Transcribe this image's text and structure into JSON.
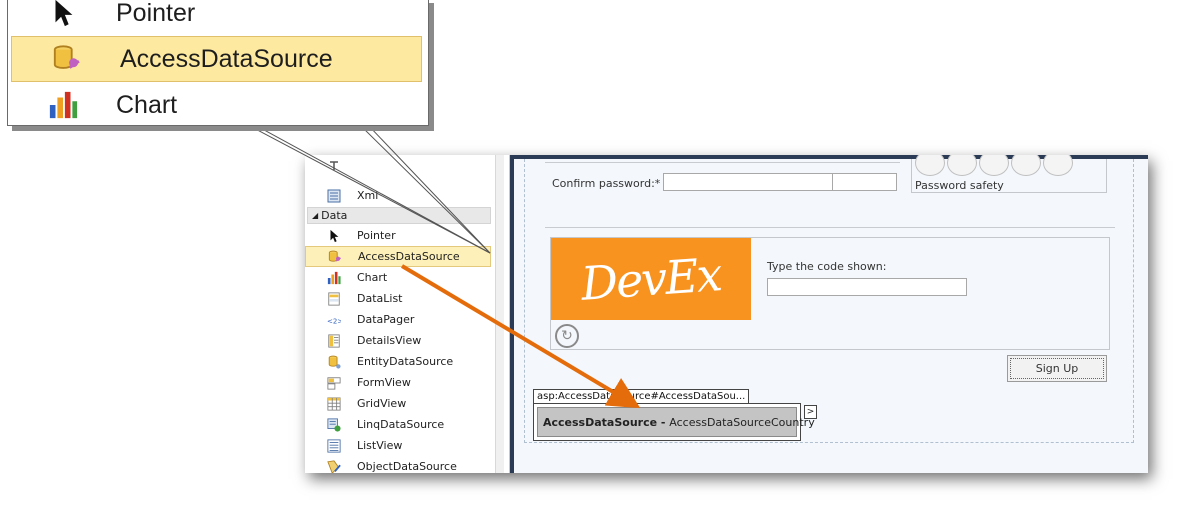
{
  "toolbox": {
    "partial_item": "Xml",
    "group_label": "Data",
    "items": [
      {
        "label": "Pointer",
        "icon": "pointer-icon"
      },
      {
        "label": "AccessDataSource",
        "icon": "access-data-source-icon"
      },
      {
        "label": "Chart",
        "icon": "chart-icon"
      },
      {
        "label": "DataList",
        "icon": "datalist-icon"
      },
      {
        "label": "DataPager",
        "icon": "datapager-icon"
      },
      {
        "label": "DetailsView",
        "icon": "detailsview-icon"
      },
      {
        "label": "EntityDataSource",
        "icon": "entity-data-source-icon"
      },
      {
        "label": "FormView",
        "icon": "formview-icon"
      },
      {
        "label": "GridView",
        "icon": "gridview-icon"
      },
      {
        "label": "LinqDataSource",
        "icon": "linq-data-source-icon"
      },
      {
        "label": "ListView",
        "icon": "listview-icon"
      },
      {
        "label": "ObjectDataSource",
        "icon": "object-data-source-icon"
      }
    ]
  },
  "designer": {
    "confirm_password_label": "Confirm password:*",
    "password_safety_label": "Password safety",
    "captcha_text": "DevEx",
    "captcha_prompt": "Type the code shown:",
    "signup_label": "Sign Up",
    "datasource_tag": "asp:AccessDataSource#AccessDataSou...",
    "datasource_type": "AccessDataSource",
    "datasource_separator": " - ",
    "datasource_id": "AccessDataSourceCountry",
    "smart_tag_glyph": ">"
  },
  "callout": {
    "items": [
      {
        "label": "Pointer",
        "icon": "pointer-icon"
      },
      {
        "label": "AccessDataSource",
        "icon": "access-data-source-icon"
      },
      {
        "label": "Chart",
        "icon": "chart-icon"
      }
    ]
  },
  "colors": {
    "selection": "#fdf0b8",
    "arrow": "#e46c0a",
    "captcha_bg": "#f7931e",
    "designer_border": "#2b3a55"
  }
}
